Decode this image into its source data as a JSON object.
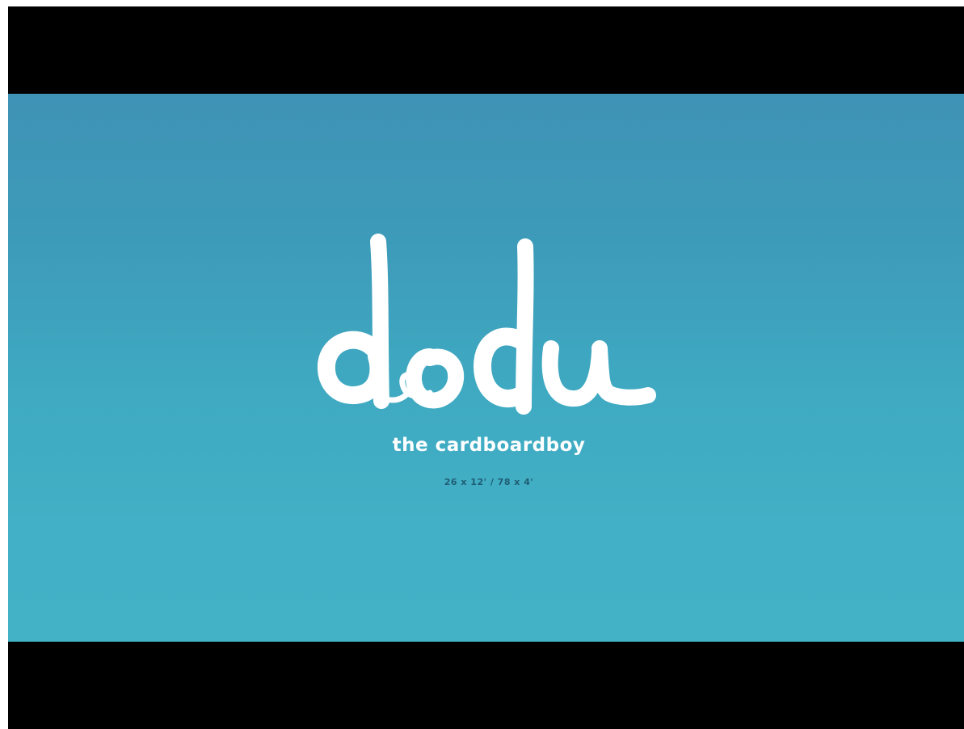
{
  "title": {
    "logo_text": "dodu",
    "subtitle": "the cardboardboy",
    "episode_info": "26 x 12'  /  78 x 4'"
  },
  "colors": {
    "letterbox": "#000000",
    "sky_top": "#3f93b6",
    "sky_bottom": "#43b1c6",
    "logo": "#ffffff",
    "episode_text": "#1f5d73"
  }
}
